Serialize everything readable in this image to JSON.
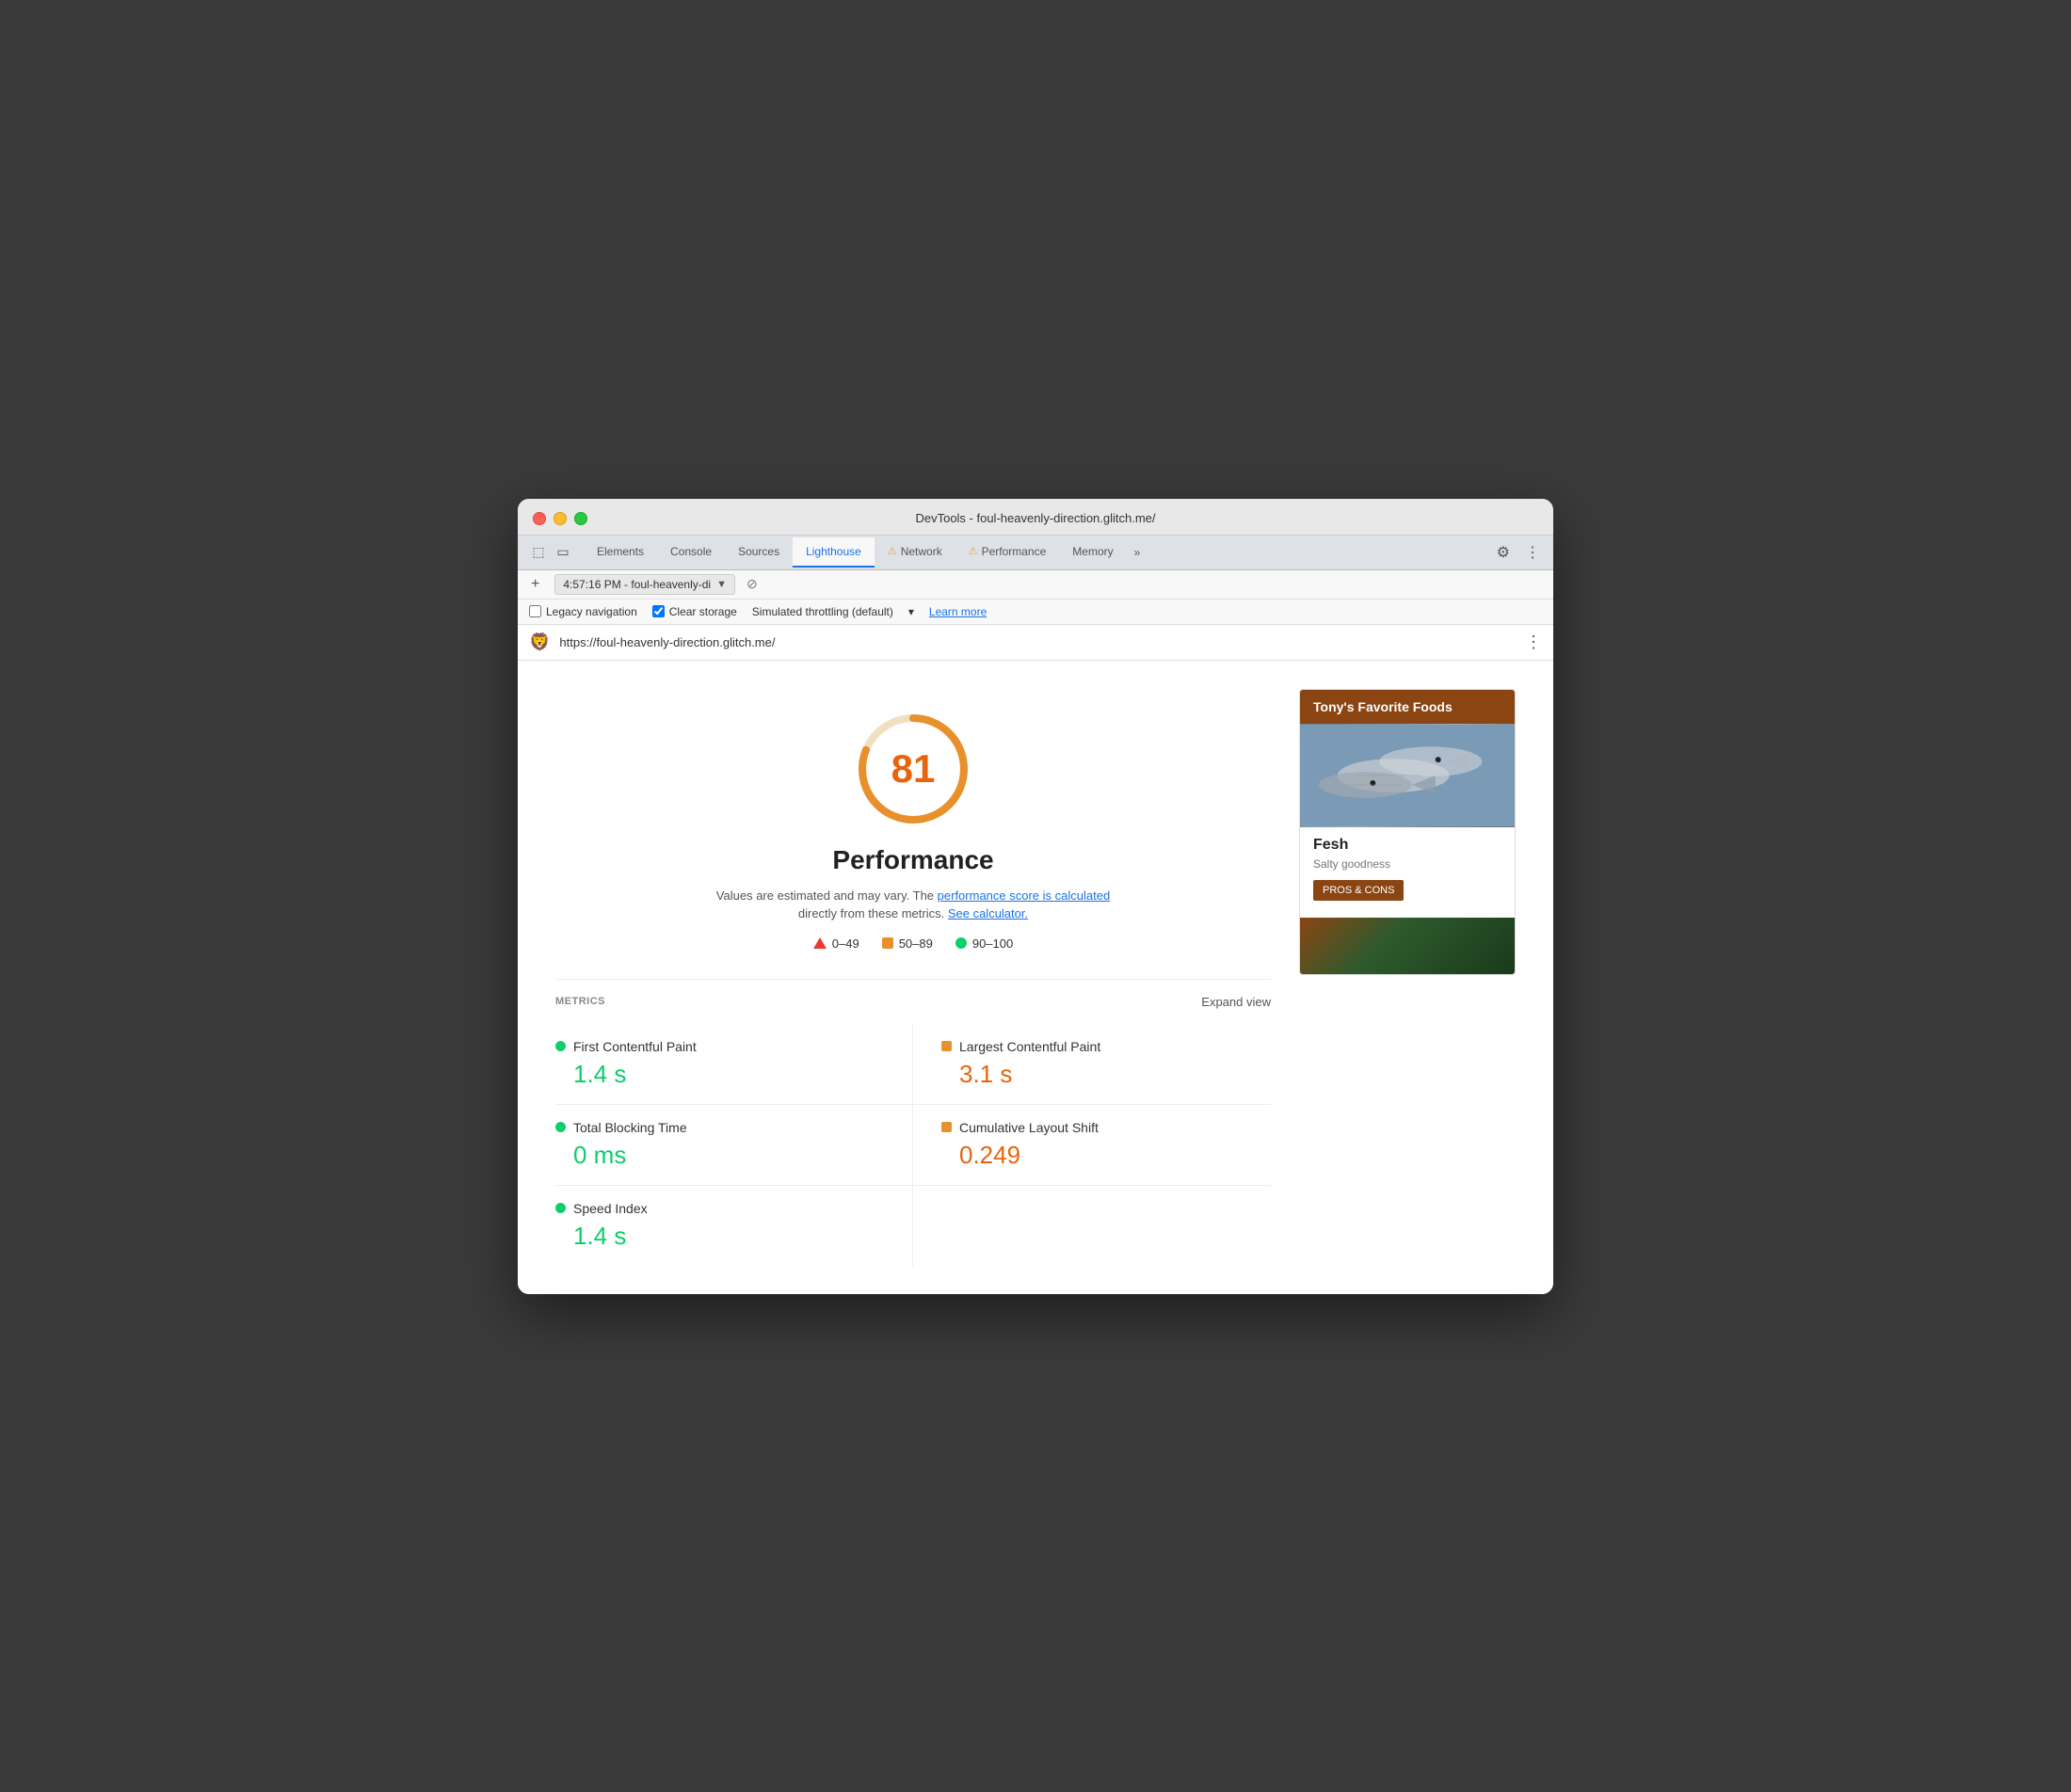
{
  "window": {
    "title": "DevTools - foul-heavenly-direction.glitch.me/"
  },
  "tabs": [
    {
      "label": "Elements",
      "active": false,
      "warning": false
    },
    {
      "label": "Console",
      "active": false,
      "warning": false
    },
    {
      "label": "Sources",
      "active": false,
      "warning": false
    },
    {
      "label": "Lighthouse",
      "active": true,
      "warning": false
    },
    {
      "label": "Network",
      "active": false,
      "warning": true
    },
    {
      "label": "Performance",
      "active": false,
      "warning": true
    },
    {
      "label": "Memory",
      "active": false,
      "warning": false
    }
  ],
  "toolbar": {
    "session_label": "4:57:16 PM - foul-heavenly-di",
    "legacy_nav_label": "Legacy navigation",
    "clear_storage_label": "Clear storage",
    "throttling_label": "Simulated throttling (default)",
    "learn_more_label": "Learn more"
  },
  "url_bar": {
    "url": "https://foul-heavenly-direction.glitch.me/"
  },
  "score": {
    "value": 81,
    "title": "Performance",
    "description_main": "Values are estimated and may vary. The",
    "link1_text": "performance score is calculated",
    "description_mid": "directly from these metrics.",
    "link2_text": "See calculator.",
    "legend": [
      {
        "range": "0–49",
        "type": "triangle"
      },
      {
        "range": "50–89",
        "type": "square"
      },
      {
        "range": "90–100",
        "type": "circle"
      }
    ]
  },
  "metrics": {
    "section_label": "METRICS",
    "expand_label": "Expand view",
    "items": [
      {
        "name": "First Contentful Paint",
        "value": "1.4 s",
        "color": "green"
      },
      {
        "name": "Largest Contentful Paint",
        "value": "3.1 s",
        "color": "orange"
      },
      {
        "name": "Total Blocking Time",
        "value": "0 ms",
        "color": "green"
      },
      {
        "name": "Cumulative Layout Shift",
        "value": "0.249",
        "color": "orange"
      },
      {
        "name": "Speed Index",
        "value": "1.4 s",
        "color": "green"
      }
    ]
  },
  "preview": {
    "header": "Tony's Favorite Foods",
    "item_name": "Fesh",
    "item_subtitle": "Salty goodness",
    "button_label": "PROS & CONS"
  }
}
